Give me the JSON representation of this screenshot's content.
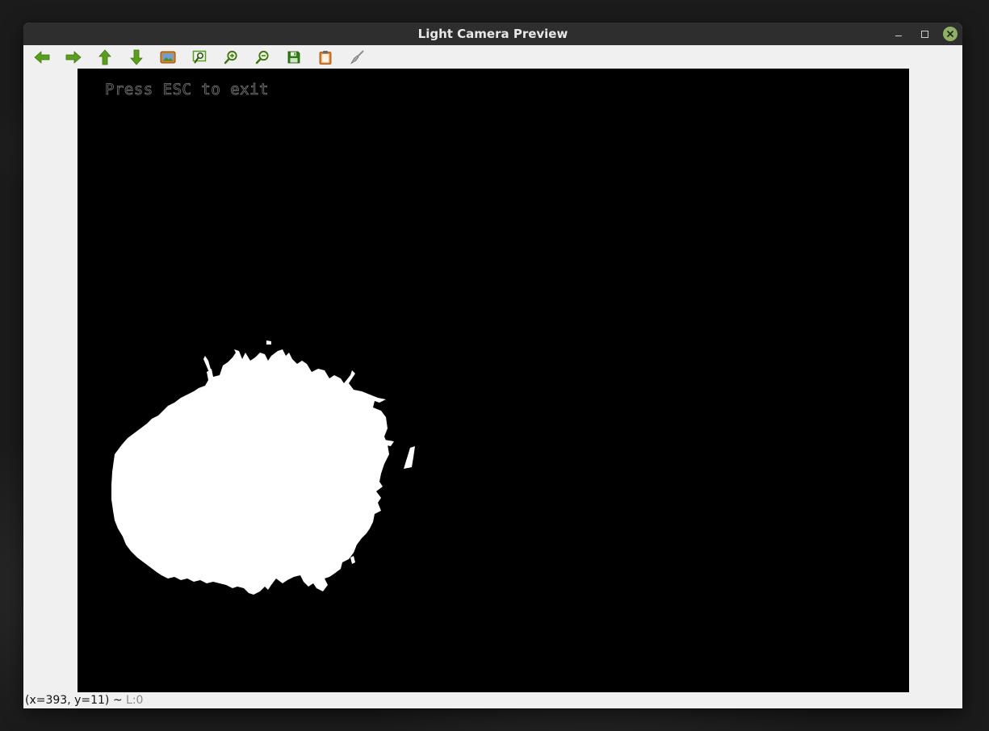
{
  "window": {
    "title": "Light Camera Preview"
  },
  "toolbar": {
    "buttons": [
      {
        "name": "pan-left-button",
        "icon": "arrow-left-icon"
      },
      {
        "name": "pan-right-button",
        "icon": "arrow-right-icon"
      },
      {
        "name": "pan-up-button",
        "icon": "arrow-up-icon"
      },
      {
        "name": "pan-down-button",
        "icon": "arrow-down-icon"
      },
      {
        "name": "zoom-fit-button",
        "icon": "image-icon"
      },
      {
        "name": "zoom-original-button",
        "icon": "zoom-rect-icon"
      },
      {
        "name": "zoom-in-button",
        "icon": "zoom-in-icon"
      },
      {
        "name": "zoom-out-button",
        "icon": "zoom-out-icon"
      },
      {
        "name": "save-button",
        "icon": "floppy-icon"
      },
      {
        "name": "copy-clipboard-button",
        "icon": "clipboard-icon"
      },
      {
        "name": "properties-button",
        "icon": "brush-icon"
      }
    ],
    "icon_color": "#5a9e1e",
    "accent_orange": "#d9822b"
  },
  "canvas": {
    "overlay_text": "Press ESC to exit",
    "background": "#000000",
    "blob_color": "#ffffff"
  },
  "status": {
    "coords": "(x=393, y=11) ~",
    "level": "L:0"
  }
}
